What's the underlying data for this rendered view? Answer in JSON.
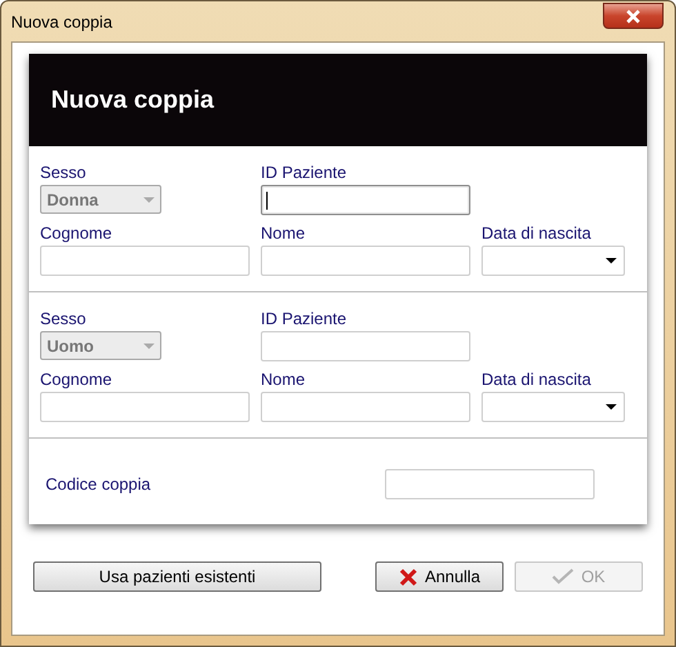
{
  "window": {
    "title": "Nuova coppia"
  },
  "header": {
    "title": "Nuova coppia"
  },
  "patients": [
    {
      "sex": {
        "label": "Sesso",
        "value": "Donna",
        "disabled": true
      },
      "patient_id": {
        "label": "ID Paziente",
        "focused": true
      },
      "surname": {
        "label": "Cognome"
      },
      "name": {
        "label": "Nome"
      },
      "birth_date": {
        "label": "Data di nascita"
      }
    },
    {
      "sex": {
        "label": "Sesso",
        "value": "Uomo",
        "disabled": true
      },
      "patient_id": {
        "label": "ID Paziente",
        "focused": false
      },
      "surname": {
        "label": "Cognome"
      },
      "name": {
        "label": "Nome"
      },
      "birth_date": {
        "label": "Data di nascita"
      }
    }
  ],
  "couple_code": {
    "label": "Codice coppia"
  },
  "buttons": [
    {
      "label": "Usa pazienti esistenti",
      "kind": "plain",
      "disabled": false
    },
    {
      "label": "Annulla",
      "kind": "cancel",
      "disabled": false
    },
    {
      "label": "OK",
      "kind": "ok",
      "disabled": true
    }
  ]
}
